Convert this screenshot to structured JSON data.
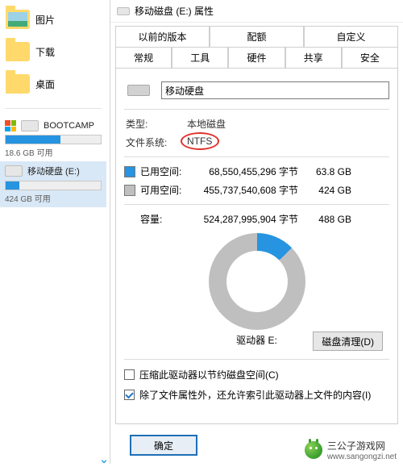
{
  "left_nav": [
    {
      "label": "图片",
      "icon": "folder-pictures"
    },
    {
      "label": "下载",
      "icon": "folder-downloads"
    },
    {
      "label": "桌面",
      "icon": "folder-desktop"
    }
  ],
  "drives": [
    {
      "name": "BOOTCAMP",
      "subtext": "18.6 GB 可用",
      "fill_percent": 58,
      "win_logo": true,
      "active": false
    },
    {
      "name": "移动硬盘 (E:)",
      "subtext": "424 GB 可用",
      "fill_percent": 14,
      "win_logo": false,
      "active": true
    }
  ],
  "dialog": {
    "title": "移动磁盘 (E:) 属性",
    "tabs_top": [
      "以前的版本",
      "配额",
      "自定义"
    ],
    "tabs_bottom": [
      "常规",
      "工具",
      "硬件",
      "共享",
      "安全"
    ],
    "active_tab": "常规",
    "name_input_value": "移动硬盘",
    "type_label": "类型:",
    "type_value": "本地磁盘",
    "fs_label": "文件系统:",
    "fs_value": "NTFS",
    "used_label": "已用空间:",
    "used_bytes": "68,550,455,296 字节",
    "used_gb": "63.8 GB",
    "free_label": "可用空间:",
    "free_bytes": "455,737,540,608 字节",
    "free_gb": "424 GB",
    "capacity_label": "容量:",
    "capacity_bytes": "524,287,995,904 字节",
    "capacity_gb": "488 GB",
    "drive_center_label": "驱动器 E:",
    "disk_cleanup_label": "磁盘清理(D)",
    "compress_checked": false,
    "compress_label": "压缩此驱动器以节约磁盘空间(C)",
    "index_checked": true,
    "index_label": "除了文件属性外，还允许索引此驱动器上文件的内容(I)",
    "ok_label": "确定",
    "used_angle_deg": 46,
    "colors": {
      "used": "#2694e0",
      "free": "#bfbfbf"
    }
  },
  "watermark": {
    "text": "三公子游戏网",
    "url": "www.sangongzi.net"
  }
}
